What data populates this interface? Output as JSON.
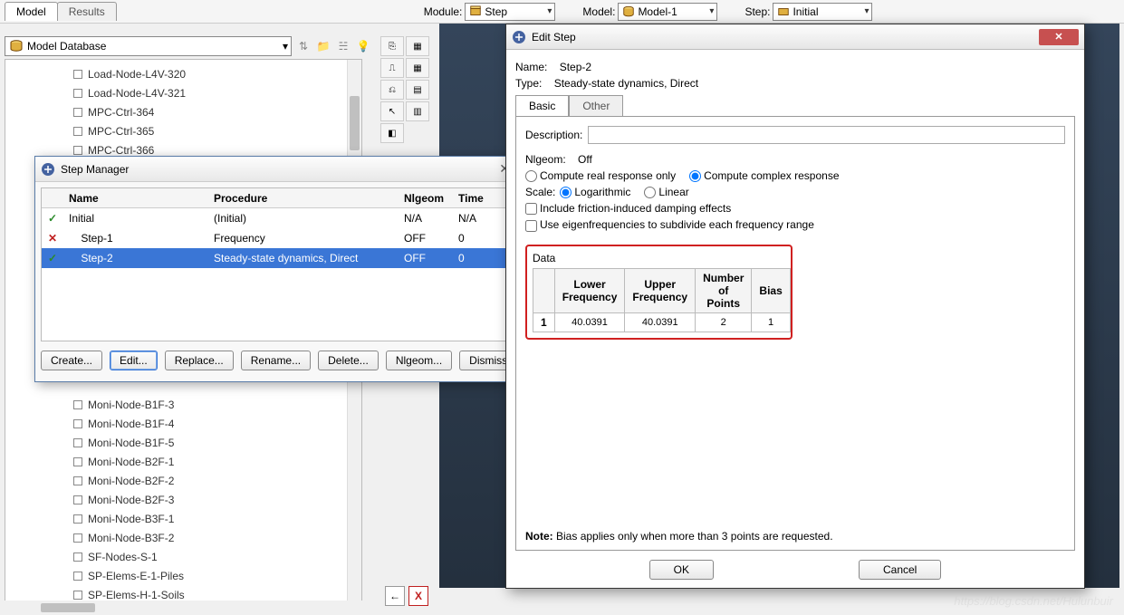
{
  "topTabs": {
    "model": "Model",
    "results": "Results"
  },
  "topBar": {
    "moduleLabel": "Module:",
    "moduleValue": "Step",
    "modelLabel": "Model:",
    "modelValue": "Model-1",
    "stepLabel": "Step:",
    "stepValue": "Initial"
  },
  "modelDb": "Model Database",
  "tree": {
    "itemsTop": [
      "Load-Node-L4V-320",
      "Load-Node-L4V-321",
      "MPC-Ctrl-364",
      "MPC-Ctrl-365",
      "MPC-Ctrl-366"
    ],
    "itemsBottom": [
      "Moni-Node-B1F-3",
      "Moni-Node-B1F-4",
      "Moni-Node-B1F-5",
      "Moni-Node-B2F-1",
      "Moni-Node-B2F-2",
      "Moni-Node-B2F-3",
      "Moni-Node-B3F-1",
      "Moni-Node-B3F-2",
      "SF-Nodes-S-1",
      "SP-Elems-E-1-Piles",
      "SP-Elems-H-1-Soils"
    ]
  },
  "stepMgr": {
    "title": "Step Manager",
    "headers": {
      "name": "Name",
      "proc": "Procedure",
      "nl": "Nlgeom",
      "time": "Time"
    },
    "rows": [
      {
        "mark": "✓",
        "markClass": "chk-g",
        "name": "Initial",
        "proc": "(Initial)",
        "nl": "N/A",
        "time": "N/A"
      },
      {
        "mark": "✕",
        "markClass": "chk-r",
        "name": "Step-1",
        "proc": "Frequency",
        "nl": "OFF",
        "time": "0"
      },
      {
        "mark": "✓",
        "markClass": "chk-g",
        "name": "Step-2",
        "proc": "Steady-state dynamics, Direct",
        "nl": "OFF",
        "time": "0",
        "selected": true
      }
    ],
    "buttons": {
      "create": "Create...",
      "edit": "Edit...",
      "replace": "Replace...",
      "rename": "Rename...",
      "delete": "Delete...",
      "nlgeom": "Nlgeom...",
      "dismiss": "Dismiss"
    }
  },
  "editStep": {
    "title": "Edit Step",
    "nameLabel": "Name:",
    "nameValue": "Step-2",
    "typeLabel": "Type:",
    "typeValue": "Steady-state dynamics, Direct",
    "tabs": {
      "basic": "Basic",
      "other": "Other"
    },
    "descLabel": "Description:",
    "nlgeomLabel": "Nlgeom:",
    "nlgeomValue": "Off",
    "radio": {
      "real": "Compute real response only",
      "complex": "Compute complex response"
    },
    "scaleLabel": "Scale:",
    "log": "Logarithmic",
    "lin": "Linear",
    "chk1": "Include friction-induced damping effects",
    "chk2": "Use eigenfrequencies to subdivide each frequency range",
    "dataTitle": "Data",
    "dataHeaders": {
      "lower": "Lower Frequency",
      "upper": "Upper Frequency",
      "npts": "Number of Points",
      "bias": "Bias"
    },
    "dataRows": [
      {
        "idx": "1",
        "lower": "40.0391",
        "upper": "40.0391",
        "npts": "2",
        "bias": "1"
      }
    ],
    "noteLabel": "Note:",
    "noteText": "Bias applies only when more than 3 points are requested.",
    "ok": "OK",
    "cancel": "Cancel"
  },
  "navBack": "←",
  "navX": "X",
  "watermark": "https://blog.csdn.net/Hulunbuir"
}
